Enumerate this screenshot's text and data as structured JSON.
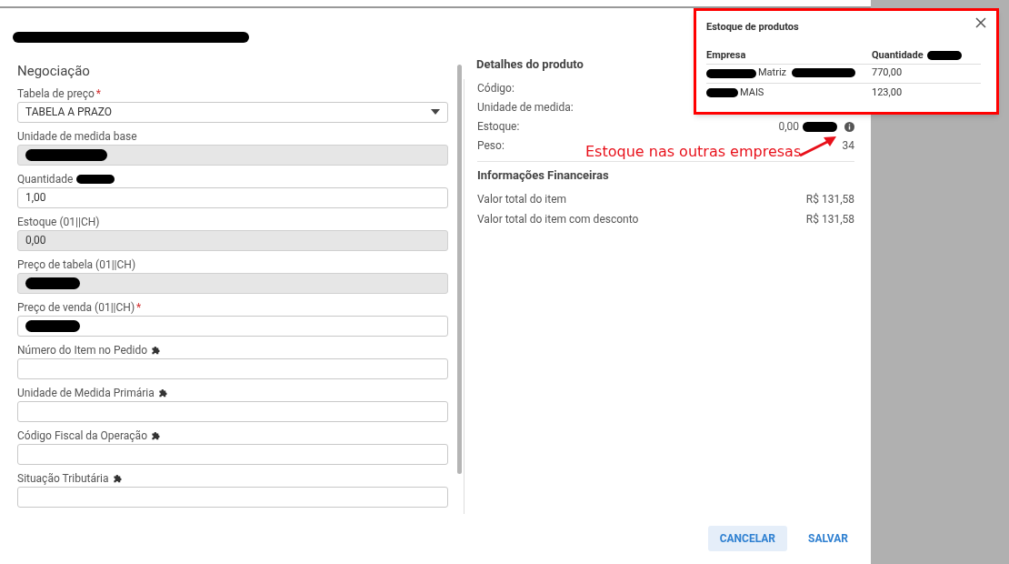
{
  "dialog": {
    "title_redacted": true,
    "form": {
      "section": "Negociação",
      "fields": [
        {
          "label": "Tabela de preço",
          "required_mark": "*",
          "kind": "select",
          "value": "TABELA A PRAZO",
          "readonly": false
        },
        {
          "label": "Unidade de medida base",
          "kind": "input",
          "readonly": true,
          "value_redacted": true
        },
        {
          "label": "Quantidade",
          "label_redacted": true,
          "kind": "input",
          "value": "1,00",
          "readonly": false
        },
        {
          "label": "Estoque (01||CH)",
          "kind": "input",
          "value": "0,00",
          "readonly": true
        },
        {
          "label": "Preço de tabela (01||CH)",
          "kind": "input",
          "readonly": true,
          "value_redacted": true
        },
        {
          "label": "Preço de venda (01||CH)",
          "required_mark": "*",
          "kind": "input",
          "readonly": false,
          "value_redacted": true
        },
        {
          "label": "Número do Item no Pedido",
          "custom": true,
          "kind": "input",
          "readonly": false
        },
        {
          "label": "Unidade de Medida Primária",
          "custom": true,
          "kind": "input",
          "readonly": false
        },
        {
          "label": "Código Fiscal da Operação",
          "custom": true,
          "kind": "input",
          "readonly": false
        },
        {
          "label": "Situação Tributária",
          "custom": true,
          "kind": "input",
          "readonly": false
        }
      ]
    },
    "details": {
      "title": "Detalhes do produto",
      "rows": [
        {
          "label": "Código:"
        },
        {
          "label": "Unidade de medida:"
        },
        {
          "label": "Estoque:",
          "value": "0,00",
          "value_redacted": true,
          "info": true
        },
        {
          "label": "Peso:",
          "value": "34"
        }
      ]
    },
    "financial": {
      "title": "Informações Financeiras",
      "rows": [
        {
          "label": "Valor total do item",
          "value": "R$ 131,58"
        },
        {
          "label": "Valor total do item com desconto",
          "value": "R$ 131,58"
        }
      ]
    },
    "buttons": [
      {
        "label": "CANCELAR",
        "kind": "tonal"
      },
      {
        "label": "SALVAR",
        "kind": "text"
      }
    ]
  },
  "popover": {
    "title": "Estoque de produtos",
    "columns": [
      {
        "label": "Empresa"
      },
      {
        "label": "Quantidade",
        "redacted": true
      }
    ],
    "rows": [
      {
        "company": "Matriz",
        "quantity": "770,00"
      },
      {
        "company": "MAIS",
        "quantity": "123,00"
      }
    ]
  },
  "annotation": {
    "text": "Estoque nas outras empresas"
  }
}
